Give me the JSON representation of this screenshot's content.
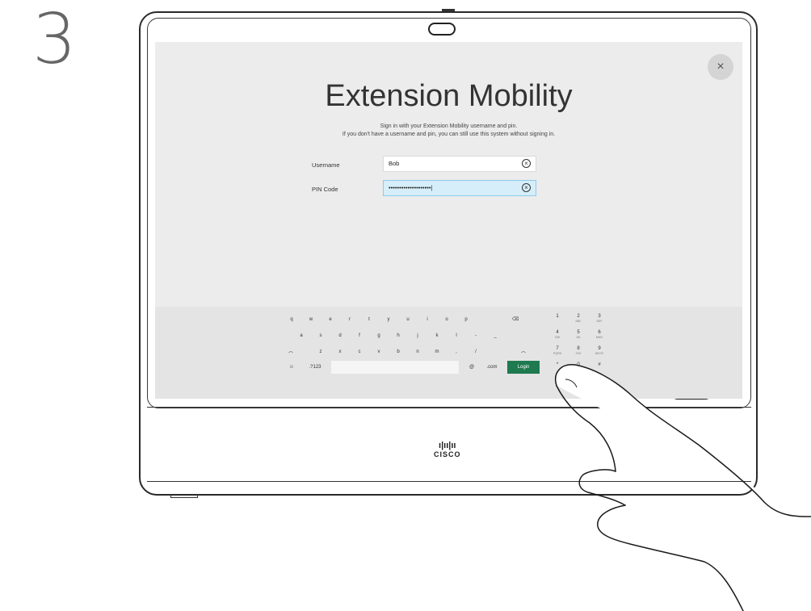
{
  "step_number": "3",
  "dialog": {
    "title": "Extension Mobility",
    "subtitle_line1": "Sign in with your Extension Mobility username and pin.",
    "subtitle_line2": "If you don't have a username and pin, you can still use this system without signing in.",
    "close_glyph": "×"
  },
  "form": {
    "username_label": "Username",
    "username_value": "Bob",
    "pin_label": "PIN Code",
    "pin_value": "••••••••••••••••••••|"
  },
  "keyboard": {
    "row1": [
      "q",
      "w",
      "e",
      "r",
      "t",
      "y",
      "u",
      "i",
      "o",
      "p"
    ],
    "row2": [
      "a",
      "s",
      "d",
      "f",
      "g",
      "h",
      "j",
      "k",
      "l",
      "-",
      "_"
    ],
    "row3": [
      "z",
      "x",
      "c",
      "v",
      "b",
      "n",
      "m",
      ",",
      "/"
    ],
    "backspace": "⌫",
    "shift": "︿",
    "emoji": "☺",
    "symbols": ".?123",
    "at": "@",
    "dotcom": ".com",
    "login": "Login",
    "numpad": [
      {
        "num": "1",
        "sub": ""
      },
      {
        "num": "2",
        "sub": "ABC"
      },
      {
        "num": "3",
        "sub": "DEF"
      },
      {
        "num": "4",
        "sub": "GHI"
      },
      {
        "num": "5",
        "sub": "JKL"
      },
      {
        "num": "6",
        "sub": "MNO"
      },
      {
        "num": "7",
        "sub": "PQRS"
      },
      {
        "num": "8",
        "sub": "TUV"
      },
      {
        "num": "9",
        "sub": "WXYZ"
      },
      {
        "num": "*",
        "sub": ""
      },
      {
        "num": "0",
        "sub": ""
      },
      {
        "num": "#",
        "sub": ""
      }
    ]
  },
  "device": {
    "logo_text": "CISCO",
    "logo_bars": "ı|ıı|ıı",
    "volume_minus": "−",
    "volume_plus": "+"
  }
}
